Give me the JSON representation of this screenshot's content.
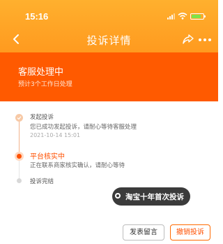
{
  "status_bar": {
    "time": "15:16"
  },
  "nav": {
    "title": "投诉详情"
  },
  "banner": {
    "title": "客服处理中",
    "subtitle": "预计3个工作日处理"
  },
  "timeline": {
    "steps": [
      {
        "title": "发起投诉",
        "desc": "您已成功发起投诉，请耐心等待客服处理",
        "time": "2021-10-14 15:01",
        "state": "done"
      },
      {
        "title": "平台核实中",
        "desc": "正在联系商家核实确认，请耐心等待",
        "state": "current"
      },
      {
        "title": "投诉完结",
        "state": "pending"
      }
    ]
  },
  "tip": {
    "text": "淘宝十年首次投诉"
  },
  "actions": {
    "comment_label": "发表留言",
    "cancel_label": "撤销投诉"
  },
  "colors": {
    "accent": "#ff5000",
    "banner": "#ff5a00",
    "header": "#ffa726",
    "battery": "#7ee34a"
  }
}
